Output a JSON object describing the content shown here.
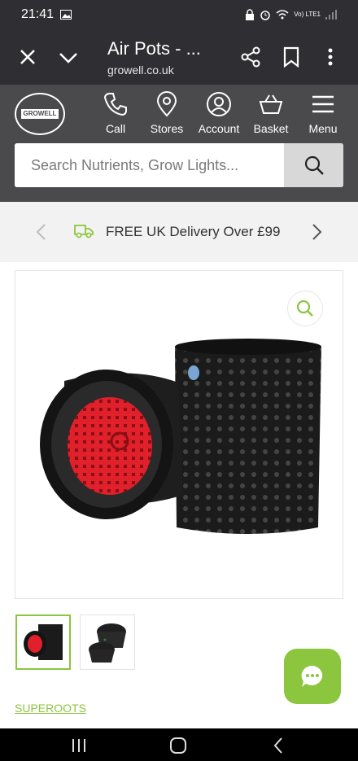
{
  "status_bar": {
    "time": "21:41",
    "network": "Vo) LTE1"
  },
  "browser": {
    "title": "Air Pots - ...",
    "url": "growell.co.uk"
  },
  "site": {
    "logo_text": "GROWELL",
    "nav": [
      {
        "label": "Call",
        "icon": "phone-icon"
      },
      {
        "label": "Stores",
        "icon": "location-pin-icon"
      },
      {
        "label": "Account",
        "icon": "user-icon"
      },
      {
        "label": "Basket",
        "icon": "basket-icon"
      },
      {
        "label": "Menu",
        "icon": "hamburger-icon"
      }
    ],
    "search": {
      "placeholder": "Search Nutrients, Grow Lights..."
    }
  },
  "promo": {
    "text": "FREE UK Delivery Over £99"
  },
  "product": {
    "brand_link": "SUPEROOTS"
  },
  "colors": {
    "header_dark": "#2f2f33",
    "site_header": "#4a4a4d",
    "accent_green": "#8cc63f",
    "promo_bg": "#f2f2f2"
  }
}
